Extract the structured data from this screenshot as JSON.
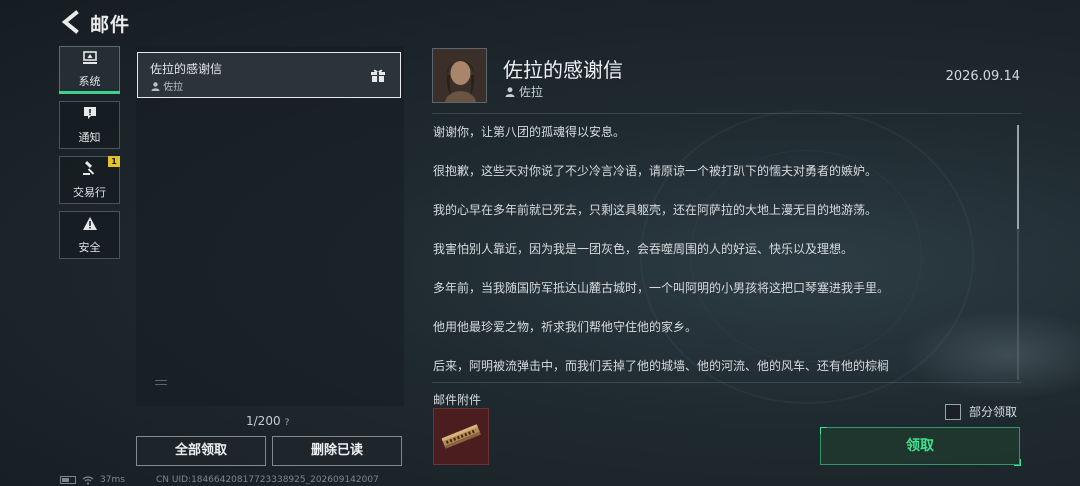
{
  "header": {
    "title": "邮件"
  },
  "tabs": [
    {
      "label": "系统",
      "icon": "monitor-icon",
      "active": true
    },
    {
      "label": "通知",
      "icon": "exclamation-icon",
      "active": false
    },
    {
      "label": "交易行",
      "icon": "gavel-icon",
      "active": false,
      "badge": "1"
    },
    {
      "label": "安全",
      "icon": "warning-icon",
      "active": false
    }
  ],
  "mail_list": {
    "items": [
      {
        "subject": "佐拉的感谢信",
        "sender": "佐拉",
        "has_gift": true,
        "selected": true
      }
    ],
    "pager": "1/200",
    "help_glyph": "?",
    "claim_all_label": "全部领取",
    "delete_read_label": "删除已读"
  },
  "status_bar": {
    "ping": "37ms",
    "uid": "CN UID:18466420817723338925_202609142007"
  },
  "detail": {
    "subject": "佐拉的感谢信",
    "sender": "佐拉",
    "date": "2026.09.14",
    "paragraphs": [
      "谢谢你，让第八团的孤魂得以安息。",
      "很抱歉，这些天对你说了不少冷言冷语，请原谅一个被打趴下的懦夫对勇者的嫉妒。",
      "我的心早在多年前就已死去，只剩这具躯壳，还在阿萨拉的大地上漫无目的地游荡。",
      "我害怕别人靠近，因为我是一团灰色，会吞噬周围的人的好运、快乐以及理想。",
      "多年前，当我随国防军抵达山麓古城时，一个叫阿明的小男孩将这把口琴塞进我手里。",
      "他用他最珍爱之物，祈求我们帮他守住他的家乡。",
      "后来，阿明被流弹击中，而我们丢掉了他的城墙、他的河流、他的风车、还有他的棕榈"
    ],
    "scroll_fraction": 0.0,
    "attachments_label": "邮件附件",
    "attachments": [
      {
        "icon": "harmonica-icon"
      }
    ],
    "partial_claim_label": "部分领取",
    "partial_checked": false,
    "claim_label": "领取"
  },
  "colors": {
    "accent_green": "#3fd08a",
    "badge_yellow": "#e5c12d",
    "attachment_bg": "#4a1e1e"
  }
}
